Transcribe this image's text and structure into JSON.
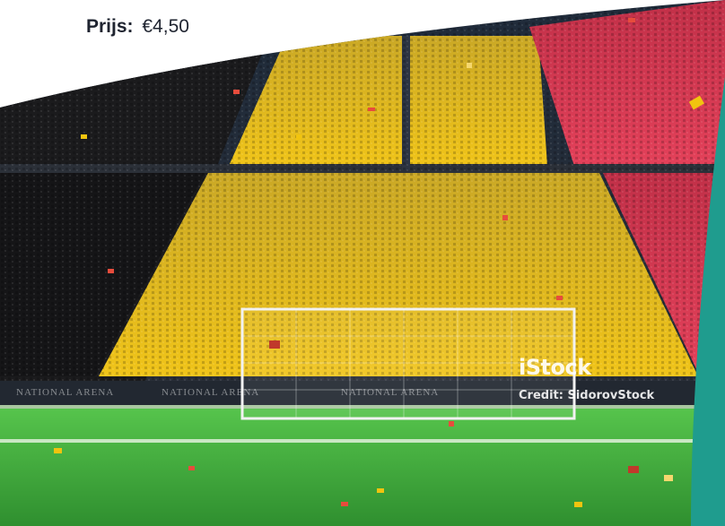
{
  "price": {
    "label": "Prijs:",
    "value": "€4,50"
  },
  "photo": {
    "watermark": {
      "logo": "iStock",
      "credit": "Credit: SidorovStock"
    },
    "board_text": [
      "NATIONAL ARENA",
      "NATIONAL ARENA",
      "NATIONAL ARENA"
    ]
  },
  "colors": {
    "flag_black": "#161616",
    "flag_yellow": "#e8c21a",
    "flag_red": "#d8344a",
    "pitch": "#3aa53b",
    "teal_accent": "#1f9c8e"
  }
}
